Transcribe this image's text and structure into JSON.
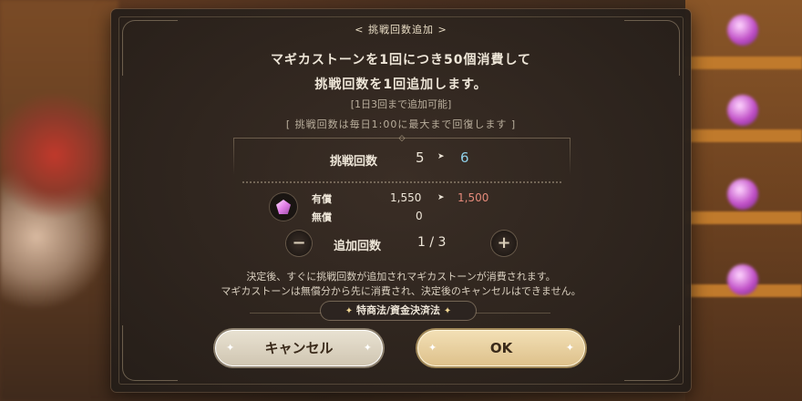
{
  "dialog": {
    "title": "< 挑戦回数追加 >",
    "message_line1": "マギカストーンを1回につき50個消費して",
    "message_line2": "挑戦回数を1回追加します。",
    "note_daily_limit": "[1日3回まで追加可能]",
    "note_recovery": "[ 挑戦回数は毎日1:00に最大まで回復します ]"
  },
  "attempts": {
    "label": "挑戦回数",
    "current": "5",
    "after": "6",
    "arrow": "➤"
  },
  "currency": {
    "icon": "magica-stone-icon",
    "paid_label": "有償",
    "paid_current": "1,550",
    "paid_after": "1,500",
    "free_label": "無償",
    "free_current": "0",
    "arrow": "➤"
  },
  "add_count": {
    "minus_label": "−",
    "label": "追加回数",
    "value": "1 / 3",
    "plus_label": "+"
  },
  "footer": {
    "notice_line1": "決定後、すぐに挑戦回数が追加されマギカストーンが消費されます。",
    "notice_line2": "マギカストーンは無償分から先に消費され、決定後のキャンセルはできません。",
    "law_button": "特商法/資金決済法",
    "cancel_button": "キャンセル",
    "ok_button": "OK"
  },
  "colors": {
    "after_value_blue": "#8fd0e8",
    "after_value_red": "#e58a7a",
    "dialog_bg": "#2e2520"
  }
}
